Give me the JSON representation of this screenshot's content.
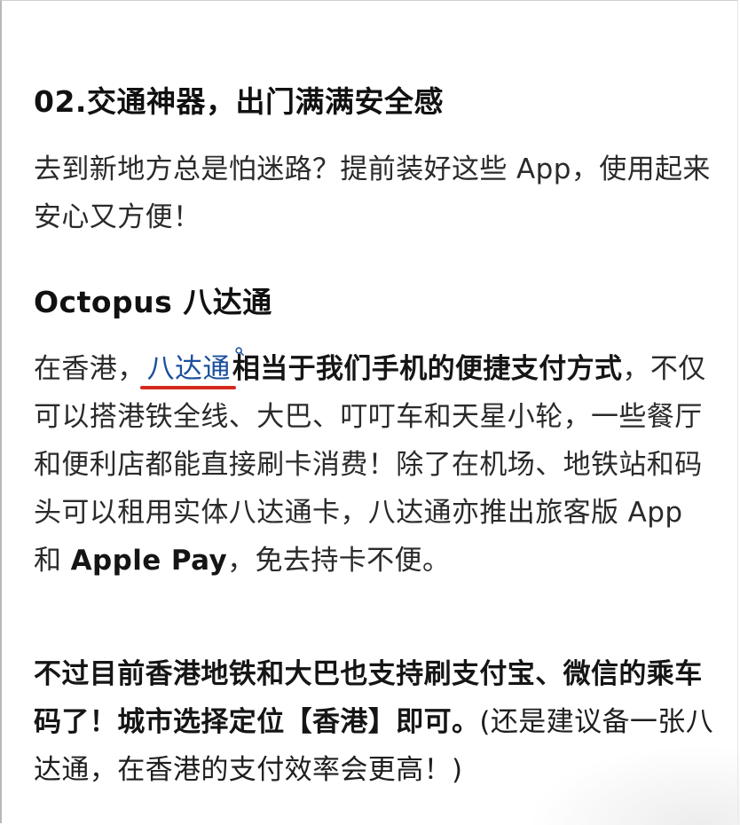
{
  "section": {
    "heading": "02.交通神器，出门满满安全感",
    "intro": "去到新地方总是怕迷路？提前装好这些 App，使用起来安心又方便！"
  },
  "app": {
    "heading": "Octopus 八达通",
    "para_prefix": "在香港，",
    "link_text": "八达通",
    "para_bold": "相当于我们手机的便捷支付方式",
    "para_mid": "，不仅可以搭港铁全线、大巴、叮叮车和天星小轮，一些餐厅和便利店都能直接刷卡消费！除了在机场、地铁站和码头可以租用实体八达通卡，八达通亦推出旅客版 App 和 ",
    "para_bold2": "Apple Pay",
    "para_end": "，免去持卡不便。"
  },
  "note": {
    "bold": "不过目前香港地铁和大巴也支持刷支付宝、微信的乘车码了！城市选择定位【香港】即可。",
    "rest": "(还是建议备一张八达通，在香港的支付效率会更高！)"
  },
  "colors": {
    "link": "#1a4f9c",
    "underline": "#d42a1e"
  }
}
